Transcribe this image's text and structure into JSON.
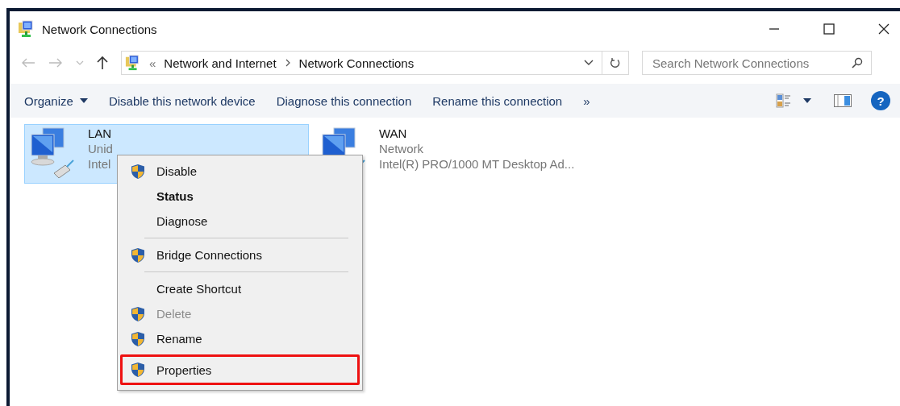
{
  "window": {
    "title": "Network Connections"
  },
  "address": {
    "overflow": "«",
    "path": [
      "Network and Internet",
      "Network Connections"
    ]
  },
  "search": {
    "placeholder": "Search Network Connections"
  },
  "toolbar": {
    "items": [
      {
        "label": "Organize",
        "kind": "menu"
      },
      {
        "label": "Disable this network device",
        "kind": "button"
      },
      {
        "label": "Diagnose this connection",
        "kind": "button"
      },
      {
        "label": "Rename this connection",
        "kind": "button"
      },
      {
        "label": "»",
        "kind": "button"
      }
    ],
    "help": "?"
  },
  "connections": [
    {
      "name": "LAN",
      "status": "Unid",
      "adapter": "Intel",
      "selected": true
    },
    {
      "name": "WAN",
      "status": "Network",
      "adapter": "Intel(R) PRO/1000 MT Desktop Ad...",
      "selected": false
    }
  ],
  "context_menu": {
    "items": [
      {
        "kind": "item",
        "label": "Disable",
        "shield": true,
        "disabled": false,
        "default": false,
        "highlighted": false
      },
      {
        "kind": "item",
        "label": "Status",
        "shield": false,
        "disabled": false,
        "default": true,
        "highlighted": false
      },
      {
        "kind": "item",
        "label": "Diagnose",
        "shield": false,
        "disabled": false,
        "default": false,
        "highlighted": false
      },
      {
        "kind": "separator"
      },
      {
        "kind": "item",
        "label": "Bridge Connections",
        "shield": true,
        "disabled": false,
        "default": false,
        "highlighted": false
      },
      {
        "kind": "separator"
      },
      {
        "kind": "item",
        "label": "Create Shortcut",
        "shield": false,
        "disabled": false,
        "default": false,
        "highlighted": false
      },
      {
        "kind": "item",
        "label": "Delete",
        "shield": true,
        "disabled": true,
        "default": false,
        "highlighted": false
      },
      {
        "kind": "item",
        "label": "Rename",
        "shield": true,
        "disabled": false,
        "default": false,
        "highlighted": false
      },
      {
        "kind": "item",
        "label": "Properties",
        "shield": true,
        "disabled": false,
        "default": false,
        "highlighted": true
      }
    ]
  }
}
